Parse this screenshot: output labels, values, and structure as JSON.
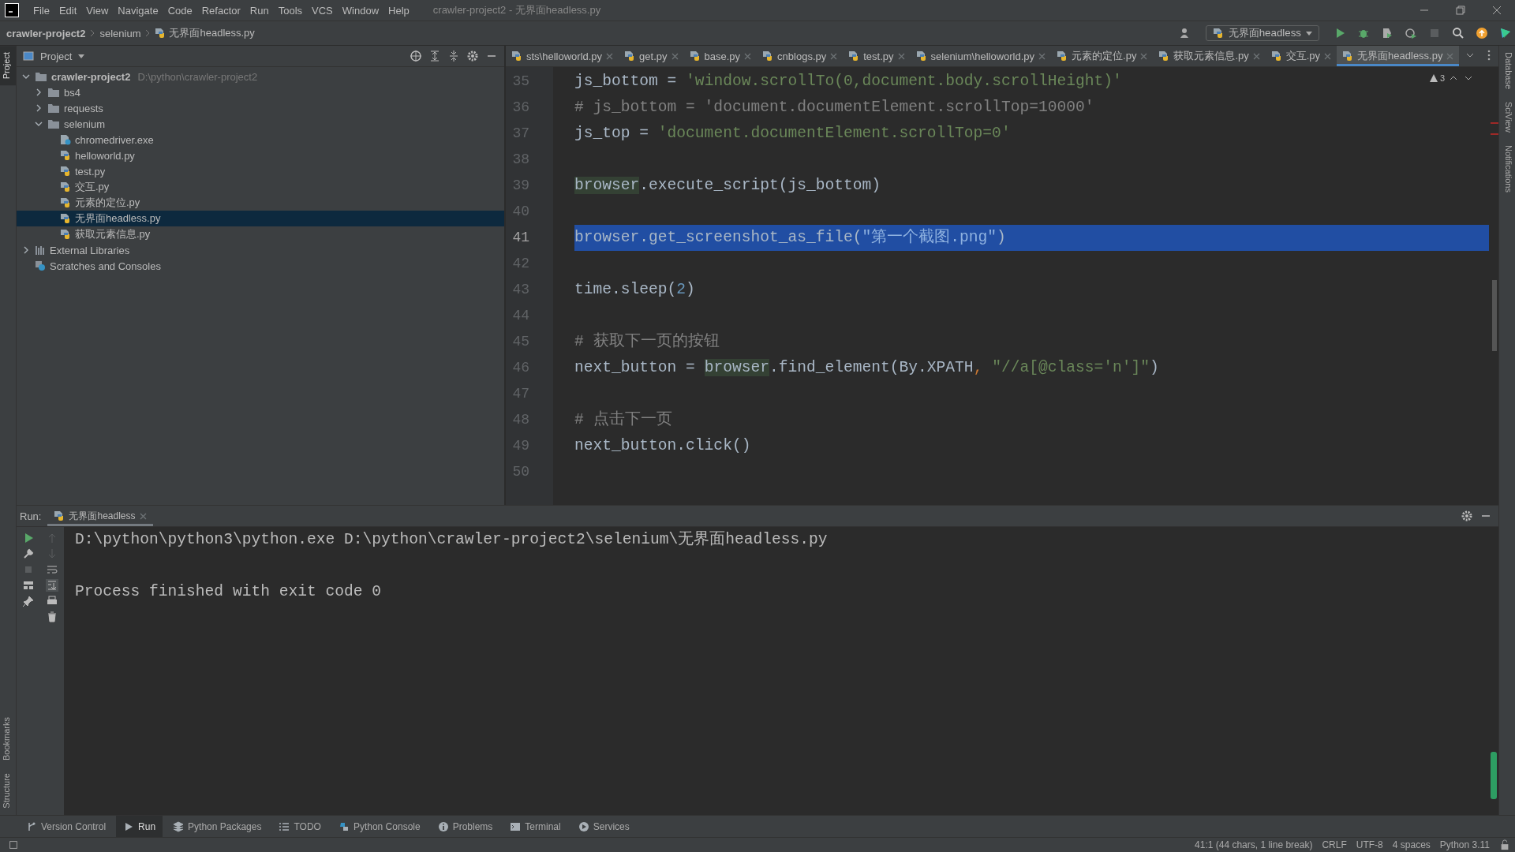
{
  "menu": {
    "items": [
      "File",
      "Edit",
      "View",
      "Navigate",
      "Code",
      "Refactor",
      "Run",
      "Tools",
      "VCS",
      "Window",
      "Help"
    ],
    "title": "crawler-project2 - 无界面headless.py"
  },
  "breadcrumbs": [
    {
      "label": "crawler-project2",
      "kind": "project"
    },
    {
      "label": "selenium",
      "kind": "folder"
    },
    {
      "label": "无界面headless.py",
      "kind": "file"
    }
  ],
  "run_config": {
    "label": "无界面headless"
  },
  "left_strip": [
    {
      "label": "Project",
      "selected": true
    },
    {
      "label": "Bookmarks",
      "selected": false
    },
    {
      "label": "Structure",
      "selected": false
    }
  ],
  "right_strip": [
    {
      "label": "Database"
    },
    {
      "label": "SciView"
    },
    {
      "label": "Notifications"
    }
  ],
  "project": {
    "title": "Project",
    "tree": [
      {
        "label": "crawler-project2",
        "hint": "D:\\python\\crawler-project2",
        "kind": "root",
        "expanded": true,
        "selected": false,
        "children": [
          {
            "label": "bs4",
            "kind": "folder",
            "expanded": false,
            "selected": false
          },
          {
            "label": "requests",
            "kind": "folder",
            "expanded": false,
            "selected": false
          },
          {
            "label": "selenium",
            "kind": "folder",
            "expanded": true,
            "selected": false,
            "children": [
              {
                "label": "chromedriver.exe",
                "kind": "exe",
                "selected": false
              },
              {
                "label": "helloworld.py",
                "kind": "py",
                "selected": false
              },
              {
                "label": "test.py",
                "kind": "py",
                "selected": false
              },
              {
                "label": "交互.py",
                "kind": "py",
                "selected": false
              },
              {
                "label": "元素的定位.py",
                "kind": "py",
                "selected": false
              },
              {
                "label": "无界面headless.py",
                "kind": "py",
                "selected": true
              },
              {
                "label": "获取元素信息.py",
                "kind": "py",
                "selected": false
              }
            ]
          }
        ]
      },
      {
        "label": "External Libraries",
        "kind": "libraries",
        "expanded": false,
        "selected": false
      },
      {
        "label": "Scratches and Consoles",
        "kind": "scratches",
        "selected": false
      }
    ]
  },
  "tabs": [
    {
      "label": "sts\\helloworld.py",
      "selected": false
    },
    {
      "label": "get.py",
      "selected": false
    },
    {
      "label": "base.py",
      "selected": false
    },
    {
      "label": "cnblogs.py",
      "selected": false
    },
    {
      "label": "test.py",
      "selected": false
    },
    {
      "label": "selenium\\helloworld.py",
      "selected": false
    },
    {
      "label": "元素的定位.py",
      "selected": false
    },
    {
      "label": "获取元素信息.py",
      "selected": false
    },
    {
      "label": "交互.py",
      "selected": false
    },
    {
      "label": "无界面headless.py",
      "selected": true
    }
  ],
  "editor": {
    "warnings": "3",
    "lines": [
      {
        "number": "35",
        "selected": false,
        "tokens": [
          {
            "text": "js_bottom = ",
            "kind": "plain"
          },
          {
            "text": "'window.scrollTo(0,document.body.scrollHeight)'",
            "kind": "string"
          }
        ]
      },
      {
        "number": "36",
        "selected": false,
        "tokens": [
          {
            "text": "# js_bottom = 'document.documentElement.scrollTop=10000'",
            "kind": "comment"
          }
        ]
      },
      {
        "number": "37",
        "selected": false,
        "tokens": [
          {
            "text": "js_top = ",
            "kind": "plain"
          },
          {
            "text": "'document.documentElement.scrollTop=0'",
            "kind": "string"
          }
        ]
      },
      {
        "number": "38",
        "selected": false
      },
      {
        "number": "39",
        "selected": false,
        "tokens": [
          {
            "text": "browser",
            "kind": "usage"
          },
          {
            "text": ".execute_script(js_bottom)",
            "kind": "plain"
          }
        ]
      },
      {
        "number": "40",
        "selected": false
      },
      {
        "number": "41",
        "selected": true,
        "tokens": [
          {
            "text": "browser.get_screenshot_as_file(",
            "kind": "plain"
          },
          {
            "text": "\"第一个截图.png\"",
            "kind": "string"
          },
          {
            "text": ")",
            "kind": "plain"
          }
        ]
      },
      {
        "number": "42",
        "selected": false
      },
      {
        "number": "43",
        "selected": false,
        "tokens": [
          {
            "text": "time.sleep(",
            "kind": "plain"
          },
          {
            "text": "2",
            "kind": "number"
          },
          {
            "text": ")",
            "kind": "plain"
          }
        ]
      },
      {
        "number": "44",
        "selected": false
      },
      {
        "number": "45",
        "selected": false,
        "tokens": [
          {
            "text": "# 获取下一页的按钮",
            "kind": "comment"
          }
        ]
      },
      {
        "number": "46",
        "selected": false,
        "tokens": [
          {
            "text": "next_button = ",
            "kind": "plain"
          },
          {
            "text": "browser",
            "kind": "usage"
          },
          {
            "text": ".find_element(By.XPATH",
            "kind": "plain"
          },
          {
            "text": ", ",
            "kind": "comma"
          },
          {
            "text": "\"//a[@class='n']\"",
            "kind": "string"
          },
          {
            "text": ")",
            "kind": "plain"
          }
        ]
      },
      {
        "number": "47",
        "selected": false
      },
      {
        "number": "48",
        "selected": false,
        "tokens": [
          {
            "text": "# 点击下一页",
            "kind": "comment"
          }
        ]
      },
      {
        "number": "49",
        "selected": false,
        "tokens": [
          {
            "text": "next_button.click()",
            "kind": "plain"
          }
        ]
      },
      {
        "number": "50",
        "selected": false
      }
    ]
  },
  "run": {
    "label": "Run:",
    "tab": "无界面headless",
    "output": [
      "D:\\python\\python3\\python.exe D:\\python\\crawler-project2\\selenium\\无界面headless.py",
      "Process finished with exit code 0"
    ]
  },
  "tool_tabs": [
    {
      "label": "Version Control",
      "selected": false
    },
    {
      "label": "Run",
      "selected": true
    },
    {
      "label": "Python Packages",
      "selected": false
    },
    {
      "label": "TODO",
      "selected": false
    },
    {
      "label": "Python Console",
      "selected": false
    },
    {
      "label": "Problems",
      "selected": false
    },
    {
      "label": "Terminal",
      "selected": false
    },
    {
      "label": "Services",
      "selected": false
    }
  ],
  "status": [
    "41:1 (44 chars, 1 line break)",
    "CRLF",
    "UTF-8",
    "4 spaces",
    "Python 3.11"
  ]
}
